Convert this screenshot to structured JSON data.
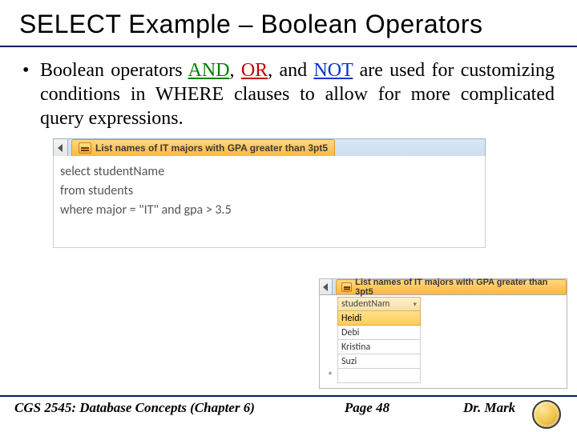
{
  "title": "SELECT Example – Boolean Operators",
  "body": {
    "pre": "Boolean operators ",
    "and": "AND",
    "or": "OR",
    "conj": "and ",
    "not": "NOT",
    "post": " are used for customizing conditions in WHERE clauses to allow for more complicated query expressions."
  },
  "tabs": {
    "query_label": "List names of IT majors with GPA greater than 3pt5"
  },
  "sql": {
    "line1": "select studentName",
    "line2": "from students",
    "line3": "where major = \"IT\" and gpa > 3.5"
  },
  "grid": {
    "header": "studentNam",
    "rows": [
      "Heidi",
      "Debi",
      "Kristina",
      "Suzi"
    ],
    "new_marker": "*"
  },
  "footer": {
    "left": "CGS 2545: Database Concepts  (Chapter 6)",
    "page": "Page 48",
    "right": "Dr. Mark"
  }
}
